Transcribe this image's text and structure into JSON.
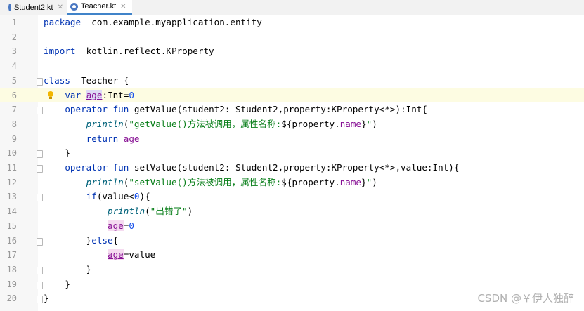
{
  "tabs": [
    {
      "label": "Student2.kt",
      "active": false,
      "icon": "kotlin-file-icon"
    },
    {
      "label": "Teacher.kt",
      "active": true,
      "icon": "kotlin-file-icon"
    }
  ],
  "editor": {
    "current_line": 6,
    "lines": [
      {
        "n": "1",
        "segs": [
          [
            "kw",
            "package"
          ],
          [
            "",
            "  com.example.myapplication.entity"
          ]
        ]
      },
      {
        "n": "2",
        "segs": []
      },
      {
        "n": "3",
        "segs": [
          [
            "kw",
            "import"
          ],
          [
            "",
            "  kotlin.reflect.KProperty"
          ]
        ]
      },
      {
        "n": "4",
        "segs": []
      },
      {
        "n": "5",
        "segs": [
          [
            "kw",
            "class"
          ],
          [
            "",
            "  Teacher {"
          ]
        ]
      },
      {
        "n": "6",
        "segs": [
          [
            "",
            "    "
          ],
          [
            "kw",
            "var "
          ],
          [
            "field hl-read",
            "age"
          ],
          [
            "",
            ":Int="
          ],
          [
            "num",
            "0"
          ]
        ]
      },
      {
        "n": "7",
        "segs": [
          [
            "",
            "    "
          ],
          [
            "kw",
            "operator fun "
          ],
          [
            "",
            "getValue(student2: Student2,property:KProperty<*>):Int{"
          ]
        ]
      },
      {
        "n": "8",
        "segs": [
          [
            "",
            "        "
          ],
          [
            "fn",
            "println"
          ],
          [
            "",
            "("
          ],
          [
            "str",
            "\"getValue()方法被调用，属性名称:"
          ],
          [
            "",
            "${property."
          ],
          [
            "prop",
            "name"
          ],
          [
            "",
            "}"
          ],
          [
            "str",
            "\""
          ],
          [
            "",
            ")"
          ]
        ]
      },
      {
        "n": "9",
        "segs": [
          [
            "",
            "        "
          ],
          [
            "kw",
            "return "
          ],
          [
            "field",
            "age"
          ]
        ]
      },
      {
        "n": "10",
        "segs": [
          [
            "",
            "    }"
          ]
        ]
      },
      {
        "n": "11",
        "segs": [
          [
            "",
            "    "
          ],
          [
            "kw",
            "operator fun "
          ],
          [
            "",
            "setValue(student2: Student2,property:KProperty<*>,value:Int){"
          ]
        ]
      },
      {
        "n": "12",
        "segs": [
          [
            "",
            "        "
          ],
          [
            "fn",
            "println"
          ],
          [
            "",
            "("
          ],
          [
            "str",
            "\"setValue()方法被调用，属性名称:"
          ],
          [
            "",
            "${property."
          ],
          [
            "prop",
            "name"
          ],
          [
            "",
            "}"
          ],
          [
            "str",
            "\""
          ],
          [
            "",
            ")"
          ]
        ]
      },
      {
        "n": "13",
        "segs": [
          [
            "",
            "        "
          ],
          [
            "kw",
            "if"
          ],
          [
            "",
            "(value<"
          ],
          [
            "num",
            "0"
          ],
          [
            "",
            "){"
          ]
        ]
      },
      {
        "n": "14",
        "segs": [
          [
            "",
            "            "
          ],
          [
            "fn",
            "println"
          ],
          [
            "",
            "("
          ],
          [
            "str",
            "\"出错了\""
          ],
          [
            "",
            ")"
          ]
        ]
      },
      {
        "n": "15",
        "segs": [
          [
            "",
            "            "
          ],
          [
            "field hl-write",
            "age"
          ],
          [
            "",
            "="
          ],
          [
            "num",
            "0"
          ]
        ]
      },
      {
        "n": "16",
        "segs": [
          [
            "",
            "        }"
          ],
          [
            "kw",
            "else"
          ],
          [
            "",
            "{"
          ]
        ]
      },
      {
        "n": "17",
        "segs": [
          [
            "",
            "            "
          ],
          [
            "field hl-write",
            "age"
          ],
          [
            "",
            "=value"
          ]
        ]
      },
      {
        "n": "18",
        "segs": [
          [
            "",
            "        }"
          ]
        ]
      },
      {
        "n": "19",
        "segs": [
          [
            "",
            "    }"
          ]
        ]
      },
      {
        "n": "20",
        "segs": [
          [
            "",
            "}"
          ]
        ]
      }
    ]
  },
  "watermark": "CSDN @￥伊人独醉",
  "colors": {
    "keyword": "#0033b3",
    "number": "#1750eb",
    "string": "#067d17",
    "function": "#00627a",
    "property": "#871094",
    "current_line": "#fdfce2"
  }
}
